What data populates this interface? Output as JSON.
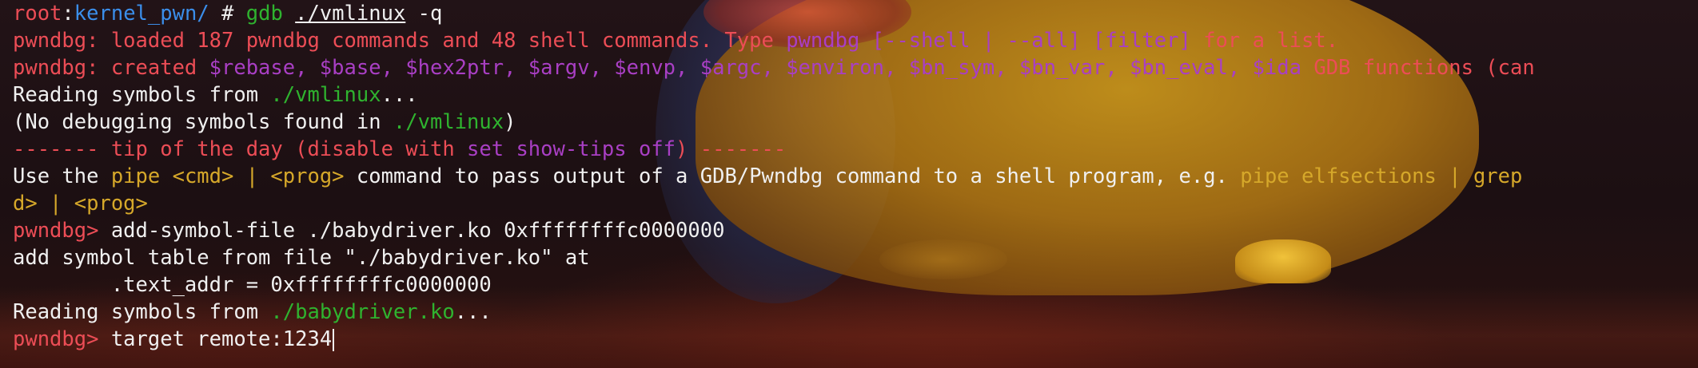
{
  "terminal": {
    "prompt_user": "root",
    "prompt_sep": ":",
    "prompt_cwd": "kernel_pwn/",
    "prompt_hash": " # ",
    "cmd_name": "gdb",
    "cmd_space": " ",
    "cmd_arg": "./vmlinux",
    "cmd_flag": " -q",
    "loaded_a": "pwndbg: loaded 187 pwndbg commands and 48 shell commands. Type ",
    "loaded_b": "pwndbg [--shell | --all] [filter]",
    "loaded_c": " for a list.",
    "created_a": "pwndbg: created ",
    "created_b": "$rebase, $base, $hex2ptr, $argv, $envp, $argc, $environ, $bn_sym, $bn_var, $bn_eval, $ida",
    "created_c": " GDB functions (can",
    "reading1_a": "Reading symbols from ",
    "reading1_b": "./vmlinux",
    "reading1_c": "...",
    "nodebug_a": "(No debugging symbols found in ",
    "nodebug_b": "./vmlinux",
    "nodebug_c": ")",
    "tip_a": "------- tip of the day (disable with ",
    "tip_b": "set show-tips off",
    "tip_c": ") -------",
    "use_a": "Use the ",
    "use_b": "pipe <cmd> | <prog>",
    "use_c": " command to pass output of a GDB/Pwndbg command to a shell program, e.g. ",
    "use_d": "pipe elfsections | grep",
    "wrap": "d> | <prog>",
    "pwndbg_prompt": "pwndbg> ",
    "cmd_addsym": "add-symbol-file ./babydriver.ko 0xffffffffc0000000",
    "addsym_out1": "add symbol table from file \"./babydriver.ko\" at",
    "addsym_out2": "        .text_addr = 0xffffffffc0000000",
    "reading2_a": "Reading symbols from ",
    "reading2_b": "./babydriver.ko",
    "reading2_c": "...",
    "cmd_target": "target remote:1234"
  },
  "colors": {
    "prompt": "#ec4d56",
    "path": "#3b8eea",
    "command": "#2fb32f",
    "purple": "#a93fc4",
    "yellow": "#d6a82a",
    "text": "#f0f0f0"
  }
}
